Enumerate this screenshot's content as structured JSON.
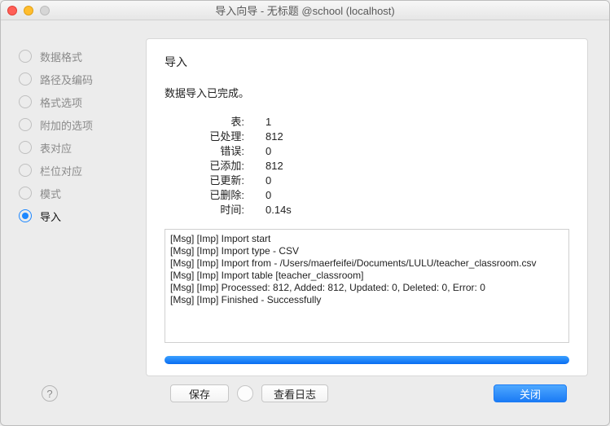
{
  "title": "导入向导 - 无标题 @school (localhost)",
  "sidebar": {
    "steps": [
      {
        "label": "数据格式"
      },
      {
        "label": "路径及编码"
      },
      {
        "label": "格式选项"
      },
      {
        "label": "附加的选项"
      },
      {
        "label": "表对应"
      },
      {
        "label": "栏位对应"
      },
      {
        "label": "模式"
      },
      {
        "label": "导入"
      }
    ]
  },
  "panel": {
    "heading": "导入",
    "message": "数据导入已完成。",
    "stats": [
      {
        "label": "表:",
        "value": "1"
      },
      {
        "label": "已处理:",
        "value": "812"
      },
      {
        "label": "错误:",
        "value": "0"
      },
      {
        "label": "已添加:",
        "value": "812"
      },
      {
        "label": "已更新:",
        "value": "0"
      },
      {
        "label": "已删除:",
        "value": "0"
      },
      {
        "label": "时间:",
        "value": "0.14s"
      }
    ],
    "log": [
      "[Msg] [Imp] Import start",
      "[Msg] [Imp] Import type - CSV",
      "[Msg] [Imp] Import from - /Users/maerfeifei/Documents/LULU/teacher_classroom.csv",
      "[Msg] [Imp] Import table [teacher_classroom]",
      "[Msg] [Imp] Processed: 812, Added: 812, Updated: 0, Deleted: 0, Error: 0",
      "[Msg] [Imp] Finished - Successfully"
    ]
  },
  "footer": {
    "help": "?",
    "save": "保存",
    "viewlog": "查看日志",
    "close": "关闭"
  }
}
